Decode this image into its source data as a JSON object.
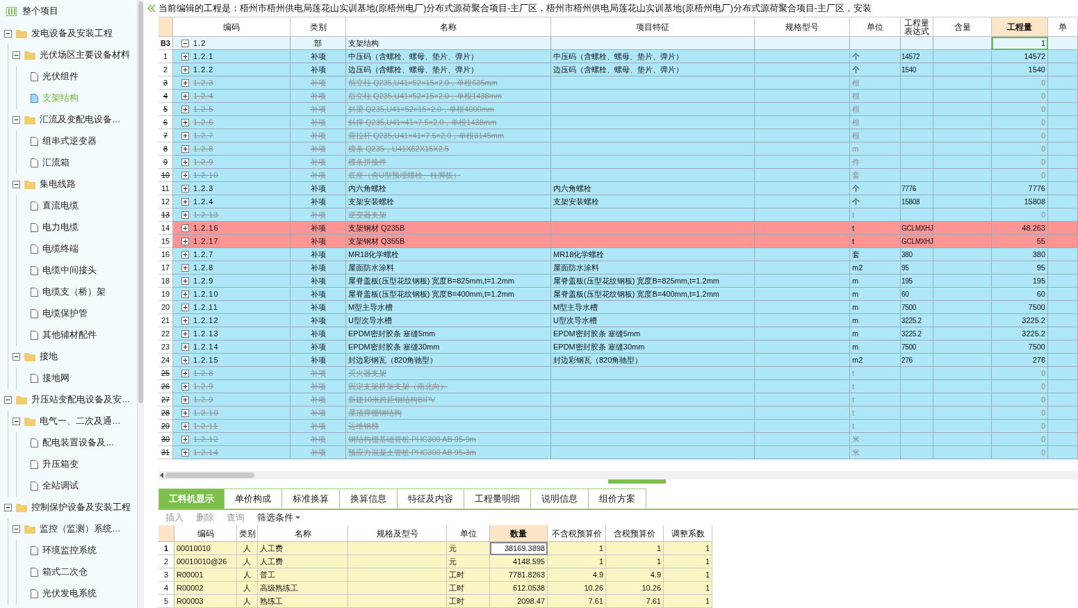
{
  "sidebar": {
    "root": {
      "label": "整个项目",
      "selected": false
    },
    "tree": [
      {
        "label": "发电设备及安装工程",
        "kind": "folder",
        "expanded": true,
        "selected": false,
        "children": [
          {
            "label": "光伏场区主要设备材料",
            "kind": "folder",
            "expanded": true,
            "selected": false,
            "children": [
              {
                "label": "光伏组件",
                "kind": "file",
                "selected": false
              },
              {
                "label": "支架结构",
                "kind": "file",
                "selected": true
              }
            ]
          },
          {
            "label": "汇流及变配电设备…",
            "kind": "folder",
            "expanded": true,
            "selected": false,
            "children": [
              {
                "label": "组串式逆变器",
                "kind": "file",
                "selected": false
              },
              {
                "label": "汇流箱",
                "kind": "file",
                "selected": false
              }
            ]
          },
          {
            "label": "集电线路",
            "kind": "folder",
            "expanded": true,
            "selected": false,
            "children": [
              {
                "label": "直流电缆",
                "kind": "file",
                "selected": false
              },
              {
                "label": "电力电缆",
                "kind": "file",
                "selected": false
              },
              {
                "label": "电缆终端",
                "kind": "file",
                "selected": false
              },
              {
                "label": "电缆中间接头",
                "kind": "file",
                "selected": false
              },
              {
                "label": "电缆支（桥）架",
                "kind": "file",
                "selected": false
              },
              {
                "label": "电缆保护管",
                "kind": "file",
                "selected": false
              },
              {
                "label": "其他辅材配件",
                "kind": "file",
                "selected": false
              }
            ]
          },
          {
            "label": "接地",
            "kind": "folder",
            "expanded": true,
            "selected": false,
            "children": [
              {
                "label": "接地网",
                "kind": "file",
                "selected": false
              }
            ]
          }
        ]
      },
      {
        "label": "升压站变配电设备及安…",
        "kind": "folder",
        "expanded": true,
        "selected": false,
        "children": [
          {
            "label": "电气一、二次及通…",
            "kind": "folder",
            "expanded": true,
            "selected": false,
            "children": [
              {
                "label": "配电装置设备及…",
                "kind": "file",
                "selected": false
              },
              {
                "label": "升压箱变",
                "kind": "file",
                "selected": false
              },
              {
                "label": "全站调试",
                "kind": "file",
                "selected": false
              }
            ]
          }
        ]
      },
      {
        "label": "控制保护设备及安装工程",
        "kind": "folder",
        "expanded": true,
        "selected": false,
        "children": [
          {
            "label": "监控（监测）系统…",
            "kind": "folder",
            "expanded": true,
            "selected": false,
            "children": [
              {
                "label": "环境监控系统",
                "kind": "file",
                "selected": false
              },
              {
                "label": "箱式二次仓",
                "kind": "file",
                "selected": false
              },
              {
                "label": "光伏发电系统",
                "kind": "file",
                "selected": false
              }
            ]
          }
        ]
      }
    ]
  },
  "title": "当前编辑的工程是：梧州市梧州供电局莲花山实训基地(原梧州电厂)分布式源荷聚合项目-主厂区，梧州市梧州供电局莲花山实训基地(原梧州电厂)分布式源荷聚合项目-主厂区，安装",
  "table": {
    "columns": [
      {
        "label": "编码",
        "selected": false
      },
      {
        "label": "类别",
        "selected": false
      },
      {
        "label": "名称",
        "selected": false
      },
      {
        "label": "项目特征",
        "selected": false
      },
      {
        "label": "规格型号",
        "selected": false
      },
      {
        "label": "单位",
        "selected": false
      },
      {
        "label": "工程量表达式",
        "selected": false
      },
      {
        "label": "含量",
        "selected": false
      },
      {
        "label": "工程量",
        "selected": true
      },
      {
        "label": "单",
        "selected": false
      }
    ],
    "rows": [
      {
        "num": "B3",
        "code": "1.2",
        "type": "部",
        "name": "支架结构",
        "feature": "",
        "unit": "",
        "expr": "",
        "qty": "1",
        "kind": "part",
        "expanded": true,
        "selected": true
      },
      {
        "num": "1",
        "code": "1.2.1",
        "type": "补项",
        "name": "中压码（含螺栓、螺母、垫片、弹片）",
        "feature": "中压码（含螺栓、螺母、垫片、弹片）",
        "unit": "个",
        "expr": "14572",
        "qty": "14572",
        "kind": "item",
        "expanded": false,
        "selected": false
      },
      {
        "num": "2",
        "code": "1.2.2",
        "type": "补项",
        "name": "边压码（含螺栓、螺母、垫片、弹片）",
        "feature": "边压码（含螺栓、螺母、垫片、弹片）",
        "unit": "个",
        "expr": "1540",
        "qty": "1540",
        "kind": "item",
        "expanded": false,
        "selected": false
      },
      {
        "num": "3",
        "code": "1.2.3",
        "type": "补项",
        "name": "前立柱 Q235,U41×52×15×2.0，单根635mm",
        "feature": "",
        "unit": "根",
        "expr": "",
        "qty": "0",
        "kind": "deleted",
        "expanded": false,
        "selected": false
      },
      {
        "num": "4",
        "code": "1.2.4",
        "type": "补项",
        "name": "后立柱 Q235,U41×52×15×2.0，单根1438mm",
        "feature": "",
        "unit": "根",
        "expr": "",
        "qty": "0",
        "kind": "deleted",
        "expanded": false,
        "selected": false
      },
      {
        "num": "5",
        "code": "1.2.5",
        "type": "补项",
        "name": "斜梁 Q235,U41×52×15×2.0，单根4000mm",
        "feature": "",
        "unit": "根",
        "expr": "",
        "qty": "0",
        "kind": "deleted",
        "expanded": false,
        "selected": false
      },
      {
        "num": "6",
        "code": "1.2.6",
        "type": "补项",
        "name": "斜撑 Q235,U41×41×7.5×2.0，单根1438mm",
        "feature": "",
        "unit": "根",
        "expr": "",
        "qty": "0",
        "kind": "deleted",
        "expanded": false,
        "selected": false
      },
      {
        "num": "7",
        "code": "1.2.7",
        "type": "补项",
        "name": "背拉杆 Q235,U41×41×7.5×2.0，单根3145mm",
        "feature": "",
        "unit": "根",
        "expr": "",
        "qty": "0",
        "kind": "deleted",
        "expanded": false,
        "selected": false
      },
      {
        "num": "8",
        "code": "1.2.8",
        "type": "补项",
        "name": "檩条 Q235，U41X62X15X2.5",
        "feature": "",
        "unit": "m",
        "expr": "",
        "qty": "0",
        "kind": "deleted",
        "expanded": false,
        "selected": false
      },
      {
        "num": "9",
        "code": "1.2.9",
        "type": "补项",
        "name": "檩条拼接件",
        "feature": "",
        "unit": "件",
        "expr": "",
        "qty": "0",
        "kind": "deleted",
        "expanded": false,
        "selected": false
      },
      {
        "num": "10",
        "code": "1.2.10",
        "type": "补项",
        "name": "底座（含U型预埋螺栓、柱脚板）",
        "feature": "",
        "unit": "套",
        "expr": "",
        "qty": "0",
        "kind": "deleted",
        "expanded": false,
        "selected": false
      },
      {
        "num": "11",
        "code": "1.2.3",
        "type": "补项",
        "name": "内六角螺栓",
        "feature": "内六角螺栓",
        "unit": "个",
        "expr": "7776",
        "qty": "7776",
        "kind": "item",
        "expanded": false,
        "selected": false
      },
      {
        "num": "12",
        "code": "1.2.4",
        "type": "补项",
        "name": "支架安装螺栓",
        "feature": "支架安装螺栓",
        "unit": "个",
        "expr": "15808",
        "qty": "15808",
        "kind": "item",
        "expanded": false,
        "selected": false
      },
      {
        "num": "13",
        "code": "1.2.13",
        "type": "补项",
        "name": "逆变器支架",
        "feature": "",
        "unit": "t",
        "expr": "",
        "qty": "0",
        "kind": "deleted",
        "expanded": false,
        "selected": false
      },
      {
        "num": "14",
        "code": "1.2.16",
        "type": "补项",
        "name": "支架钢材 Q235B",
        "feature": "",
        "unit": "t",
        "expr": "GCLMXHJ",
        "qty": "48.263",
        "kind": "flagged",
        "expanded": false,
        "selected": false
      },
      {
        "num": "15",
        "code": "1.2.17",
        "type": "补项",
        "name": "支架钢材 Q355B",
        "feature": "",
        "unit": "t",
        "expr": "GCLMXHJ",
        "qty": "55",
        "kind": "flagged",
        "expanded": false,
        "selected": false
      },
      {
        "num": "16",
        "code": "1.2.7",
        "type": "补项",
        "name": "MR18化学螺栓",
        "feature": "MR18化学螺栓",
        "unit": "套",
        "expr": "380",
        "qty": "380",
        "kind": "item",
        "expanded": false,
        "selected": false
      },
      {
        "num": "17",
        "code": "1.2.8",
        "type": "补项",
        "name": "屋面防水涂料",
        "feature": "屋面防水涂料",
        "unit": "m2",
        "expr": "95",
        "qty": "95",
        "kind": "item",
        "expanded": false,
        "selected": false
      },
      {
        "num": "18",
        "code": "1.2.9",
        "type": "补项",
        "name": "屋脊盖板(压型花纹钢板) 宽度B=825mm,t=1.2mm",
        "feature": "屋脊盖板(压型花纹钢板) 宽度B=825mm,t=1.2mm",
        "unit": "m",
        "expr": "195",
        "qty": "195",
        "kind": "item",
        "expanded": false,
        "selected": false
      },
      {
        "num": "19",
        "code": "1.2.10",
        "type": "补项",
        "name": "屋脊盖板(压型花纹钢板) 宽度B=400mm,t=1.2mm",
        "feature": "屋脊盖板(压型花纹钢板) 宽度B=400mm,t=1.2mm",
        "unit": "m",
        "expr": "60",
        "qty": "60",
        "kind": "item",
        "expanded": false,
        "selected": false
      },
      {
        "num": "20",
        "code": "1.2.11",
        "type": "补项",
        "name": "M型主导水槽",
        "feature": "M型主导水槽",
        "unit": "m",
        "expr": "7500",
        "qty": "7500",
        "kind": "item",
        "expanded": false,
        "selected": false
      },
      {
        "num": "21",
        "code": "1.2.12",
        "type": "补项",
        "name": "U型次导水槽",
        "feature": "U型次导水槽",
        "unit": "m",
        "expr": "3225.2",
        "qty": "3225.2",
        "kind": "item",
        "expanded": false,
        "selected": false
      },
      {
        "num": "22",
        "code": "1.2.13",
        "type": "补项",
        "name": "EPDM密封胶条 塞缝5mm",
        "feature": "EPDM密封胶条 塞缝5mm",
        "unit": "m",
        "expr": "3225.2",
        "qty": "3225.2",
        "kind": "item",
        "expanded": false,
        "selected": false
      },
      {
        "num": "23",
        "code": "1.2.14",
        "type": "补项",
        "name": "EPDM密封胶条 塞缝30mm",
        "feature": "EPDM密封胶条 塞缝30mm",
        "unit": "m",
        "expr": "7500",
        "qty": "7500",
        "kind": "item",
        "expanded": false,
        "selected": false
      },
      {
        "num": "24",
        "code": "1.2.15",
        "type": "补项",
        "name": "封边彩钢瓦（820角驰型）",
        "feature": "封边彩钢瓦（820角驰型）",
        "unit": "m2",
        "expr": "276",
        "qty": "276",
        "kind": "item",
        "expanded": false,
        "selected": false
      },
      {
        "num": "25",
        "code": "1.2.8",
        "type": "补项",
        "name": "灭火器支架",
        "feature": "",
        "unit": "t",
        "expr": "",
        "qty": "0",
        "kind": "deleted",
        "expanded": false,
        "selected": false
      },
      {
        "num": "26",
        "code": "1.2.9",
        "type": "补项",
        "name": "固定支架桥架支架（南北向）",
        "feature": "",
        "unit": "t",
        "expr": "",
        "qty": "0",
        "kind": "deleted",
        "expanded": false,
        "selected": false
      },
      {
        "num": "27",
        "code": "1.2.9",
        "type": "补项",
        "name": "新建10米跨距钢结构BIPV",
        "feature": "",
        "unit": "t",
        "expr": "",
        "qty": "0",
        "kind": "deleted",
        "expanded": false,
        "selected": false
      },
      {
        "num": "28",
        "code": "1.2.10",
        "type": "补项",
        "name": "屋顶撑棚钢结构",
        "feature": "",
        "unit": "t",
        "expr": "",
        "qty": "0",
        "kind": "deleted",
        "expanded": false,
        "selected": false
      },
      {
        "num": "29",
        "code": "1.2.11",
        "type": "补项",
        "name": "运维钢梯",
        "feature": "",
        "unit": "t",
        "expr": "",
        "qty": "0",
        "kind": "deleted",
        "expanded": false,
        "selected": false
      },
      {
        "num": "30",
        "code": "1.2.12",
        "type": "补项",
        "name": "钢结构棚基础管桩 PHC300 AB 95-9m",
        "feature": "",
        "unit": "米",
        "expr": "",
        "qty": "0",
        "kind": "deleted",
        "expanded": false,
        "selected": false
      },
      {
        "num": "31",
        "code": "1.2.14",
        "type": "补项",
        "name": "预应力混凝土管桩 PHC300 AB 95-3m",
        "feature": "",
        "unit": "米",
        "expr": "",
        "qty": "0",
        "kind": "deleted",
        "expanded": false,
        "selected": false
      }
    ]
  },
  "tabs": [
    {
      "label": "工料机显示",
      "selected": true
    },
    {
      "label": "单价构成",
      "selected": false
    },
    {
      "label": "标准换算",
      "selected": false
    },
    {
      "label": "换算信息",
      "selected": false
    },
    {
      "label": "特征及内容",
      "selected": false
    },
    {
      "label": "工程量明细",
      "selected": false
    },
    {
      "label": "说明信息",
      "selected": false
    },
    {
      "label": "组价方案",
      "selected": false
    }
  ],
  "toolbar": [
    {
      "label": "插入",
      "disabled": true,
      "kind": "button"
    },
    {
      "label": "删除",
      "disabled": true,
      "kind": "button"
    },
    {
      "label": "查询",
      "disabled": true,
      "kind": "button"
    },
    {
      "label": "筛选条件",
      "disabled": false,
      "kind": "dropdown"
    }
  ],
  "resources": {
    "columns": [
      {
        "label": "编码",
        "selected": false
      },
      {
        "label": "类别",
        "selected": false
      },
      {
        "label": "名称",
        "selected": false
      },
      {
        "label": "规格及型号",
        "selected": false
      },
      {
        "label": "单位",
        "selected": false
      },
      {
        "label": "数量",
        "selected": true
      },
      {
        "label": "不含税预算价",
        "selected": false
      },
      {
        "label": "含税预算价",
        "selected": false
      },
      {
        "label": "调整系数",
        "selected": false
      }
    ],
    "rows": [
      {
        "num": "1",
        "cells": [
          "00010010",
          "人",
          "人工费",
          "",
          "元",
          "38169.3898",
          "1",
          "1",
          "1"
        ],
        "selected": true
      },
      {
        "num": "2",
        "cells": [
          "00010010@26",
          "人",
          "人工费",
          "",
          "元",
          "4148.595",
          "1",
          "1",
          "1"
        ],
        "selected": false
      },
      {
        "num": "3",
        "cells": [
          "R00001",
          "人",
          "普工",
          "",
          "工时",
          "7781.8263",
          "4.9",
          "4.9",
          "1"
        ],
        "selected": false
      },
      {
        "num": "4",
        "cells": [
          "R00002",
          "人",
          "高级熟练工",
          "",
          "工时",
          "612.0538",
          "10.26",
          "10.26",
          "1"
        ],
        "selected": false
      },
      {
        "num": "5",
        "cells": [
          "R00003",
          "人",
          "熟练工",
          "",
          "工时",
          "2098.47",
          "7.61",
          "7.61",
          "1"
        ],
        "selected": false
      }
    ]
  }
}
